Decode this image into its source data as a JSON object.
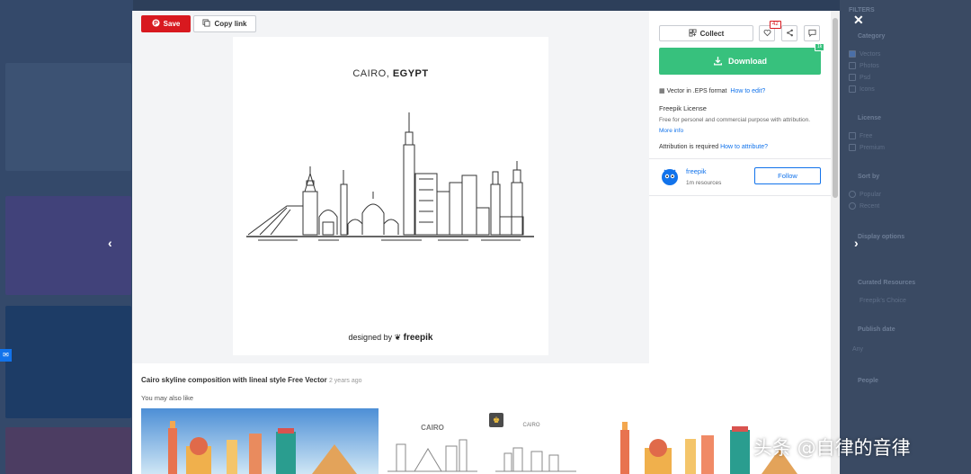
{
  "toolbar": {
    "save_label": "Save",
    "copy_label": "Copy link"
  },
  "artwork": {
    "city": "CAIRO,",
    "country": "EGYPT",
    "credit_prefix": "designed by",
    "credit_brand": "freepik"
  },
  "panel": {
    "collect_label": "Collect",
    "like_count": "42",
    "download_label": "Download",
    "download_badge": "1k",
    "format_text": "Vector in .EPS format",
    "format_link": "How to edit?",
    "license_title": "Freepik License",
    "license_text": "Free for personel and commercial purpose with attribution.",
    "license_link": "More info",
    "attribution_text": "Attribution is required",
    "attribution_link": "How to attribute?",
    "author_name": "freepik",
    "author_resources": "1m resources",
    "follow_label": "Follow"
  },
  "resource": {
    "title": "Cairo skyline composition with lineal style Free Vector",
    "age": "2 years ago",
    "also_like": "You may also like"
  },
  "filters": {
    "header": "FILTERS",
    "sections": [
      "Category",
      "License",
      "Sort by",
      "Display options",
      "Curated Resources",
      "Publish date",
      "People"
    ],
    "category_options": [
      "Vectors",
      "Photos",
      "Psd",
      "Icons"
    ],
    "license_options": [
      "Free",
      "Premium"
    ],
    "sort_options": [
      "Popular",
      "Recent"
    ],
    "curated_option": "Freepik's Choice",
    "publish_value": "Any"
  },
  "watermark": "头条 @自律的音律",
  "colors": {
    "save": "#d8191f",
    "download": "#37c17d",
    "link": "#1273eb"
  }
}
